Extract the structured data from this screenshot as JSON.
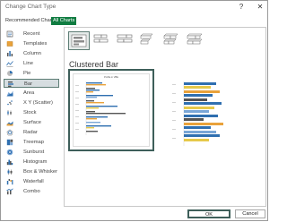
{
  "title": "Change Chart Type",
  "window_controls": {
    "help": "?",
    "close": "✕"
  },
  "tabs": [
    {
      "label": "Recommended Charts",
      "selected": false
    },
    {
      "label": "All Charts",
      "selected": true
    }
  ],
  "sidebar": {
    "items": [
      {
        "label": "Recent",
        "icon": "recent-icon"
      },
      {
        "label": "Templates",
        "icon": "templates-icon"
      },
      {
        "label": "Column",
        "icon": "column-icon"
      },
      {
        "label": "Line",
        "icon": "line-icon"
      },
      {
        "label": "Pie",
        "icon": "pie-icon"
      },
      {
        "label": "Bar",
        "icon": "bar-icon",
        "selected": true
      },
      {
        "label": "Area",
        "icon": "area-icon"
      },
      {
        "label": "X Y (Scatter)",
        "icon": "scatter-icon"
      },
      {
        "label": "Stock",
        "icon": "stock-icon"
      },
      {
        "label": "Surface",
        "icon": "surface-icon"
      },
      {
        "label": "Radar",
        "icon": "radar-icon"
      },
      {
        "label": "Treemap",
        "icon": "treemap-icon"
      },
      {
        "label": "Sunburst",
        "icon": "sunburst-icon"
      },
      {
        "label": "Histogram",
        "icon": "histogram-icon"
      },
      {
        "label": "Box & Whisker",
        "icon": "box-whisker-icon"
      },
      {
        "label": "Waterfall",
        "icon": "waterfall-icon"
      },
      {
        "label": "Combo",
        "icon": "combo-icon"
      }
    ]
  },
  "main": {
    "section_title": "Clustered Bar",
    "preview_chart_title": "Profile in VBE"
  },
  "footer": {
    "ok_label": "OK",
    "cancel_label": "Cancel"
  },
  "colors": {
    "accent": "#107c41",
    "selection": "#3e5f5a"
  }
}
